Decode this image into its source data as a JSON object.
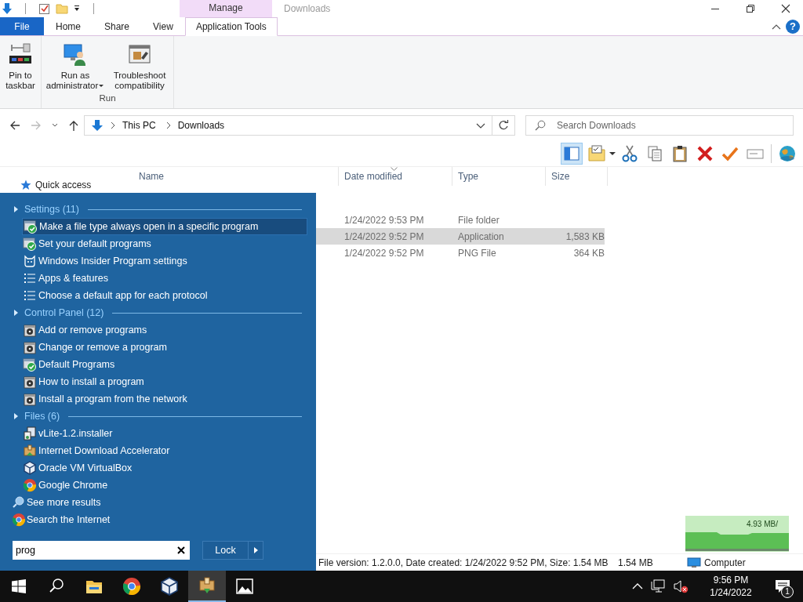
{
  "title_bar": {
    "context_tab": "Manage",
    "title": "Downloads",
    "help_button": "?"
  },
  "ribbon": {
    "tabs": [
      {
        "label": "File",
        "kind": "file",
        "selected": false
      },
      {
        "label": "Home",
        "kind": "plain",
        "selected": false
      },
      {
        "label": "Share",
        "kind": "plain",
        "selected": false
      },
      {
        "label": "View",
        "kind": "plain",
        "selected": false
      },
      {
        "label": "Application Tools",
        "kind": "context",
        "selected": true
      }
    ],
    "groups": [
      {
        "buttons": [
          {
            "label": "Pin to taskbar",
            "kind": "pin",
            "dropdown": false
          }
        ]
      },
      {
        "label": "Run",
        "buttons": [
          {
            "label": "Run as administrator",
            "kind": "admin",
            "dropdown": true
          },
          {
            "label": "Troubleshoot compatibility",
            "kind": "troubleshoot",
            "dropdown": false
          }
        ]
      }
    ]
  },
  "address_bar": {
    "path": [
      "This PC",
      "Downloads"
    ]
  },
  "search": {
    "placeholder": "Search Downloads"
  },
  "toolbar": [
    {
      "kind": "preview",
      "selected": true
    },
    {
      "kind": "folder",
      "selected": false
    },
    {
      "kind": "cut",
      "selected": false
    },
    {
      "kind": "copy",
      "selected": false
    },
    {
      "kind": "paste",
      "selected": false
    },
    {
      "kind": "delete",
      "selected": false
    },
    {
      "kind": "check",
      "selected": false
    },
    {
      "kind": "rename",
      "selected": false
    },
    {
      "kind": "globe",
      "selected": false
    }
  ],
  "columns": [
    {
      "label": "Name",
      "sorted": false
    },
    {
      "label": "Date modified",
      "sorted": true
    },
    {
      "label": "Type",
      "sorted": false
    },
    {
      "label": "Size",
      "sorted": false
    }
  ],
  "nav_pane": [
    {
      "label": "Quick access"
    }
  ],
  "rows": [
    {
      "date": "1/24/2022 9:53 PM",
      "type": "File folder",
      "selected": false
    },
    {
      "date": "1/24/2022 9:52 PM",
      "type": "Application",
      "size": "1,583 KB",
      "selected": true
    },
    {
      "date": "1/24/2022 9:52 PM",
      "type": "PNG File",
      "size": "364 KB",
      "selected": false
    }
  ],
  "status_bar": {
    "details": "File version: 1.2.0.0, Date created: 1/24/2022 9:52 PM, Size: 1.54 MB",
    "size": "1.54 MB",
    "location": "Computer"
  },
  "start_menu": {
    "sections": [
      {
        "title": "Settings (11)",
        "items": [
          {
            "label": "Make a file type always open in a specific program",
            "kind": "shield",
            "selected": true
          },
          {
            "label": "Set your default programs",
            "kind": "shield",
            "selected": false
          },
          {
            "label": "Windows Insider Program settings",
            "kind": "cat",
            "selected": false
          },
          {
            "label": "Apps & features",
            "kind": "list",
            "selected": false
          },
          {
            "label": "Choose a default app for each protocol",
            "kind": "list",
            "selected": false
          }
        ]
      },
      {
        "title": "Control Panel (12)",
        "items": [
          {
            "label": "Add or remove programs",
            "kind": "disc",
            "selected": false
          },
          {
            "label": "Change or remove a program",
            "kind": "disc",
            "selected": false
          },
          {
            "label": "Default Programs",
            "kind": "shield",
            "selected": false
          },
          {
            "label": "How to install a program",
            "kind": "disc",
            "selected": false
          },
          {
            "label": "Install a program from the network",
            "kind": "disc",
            "selected": false
          }
        ]
      },
      {
        "title": "Files (6)",
        "items": [
          {
            "label": "vLite-1.2.installer",
            "kind": "installer",
            "selected": false
          },
          {
            "label": "Internet Download Accelerator",
            "kind": "box",
            "selected": false
          },
          {
            "label": "Oracle VM VirtualBox",
            "kind": "cube",
            "selected": false
          },
          {
            "label": "Google Chrome",
            "kind": "chrome",
            "selected": false
          }
        ]
      }
    ],
    "links": [
      {
        "label": "See more results",
        "kind": "search"
      },
      {
        "label": "Search the Internet",
        "kind": "chrome"
      }
    ],
    "search": {
      "value": "prog"
    },
    "power_button": "Lock"
  },
  "speed_widget": {
    "reading": "4.93 MB/"
  },
  "taskbar": {
    "apps": [
      {
        "kind": "search",
        "active": false
      },
      {
        "kind": "explorer",
        "active": false
      },
      {
        "kind": "chrome",
        "active": false
      },
      {
        "kind": "cube",
        "active": false
      },
      {
        "kind": "box",
        "active": true
      },
      {
        "kind": "photos",
        "active": false
      }
    ],
    "clock": {
      "time": "9:56 PM",
      "date": "1/24/2022"
    },
    "notifications": "1"
  }
}
